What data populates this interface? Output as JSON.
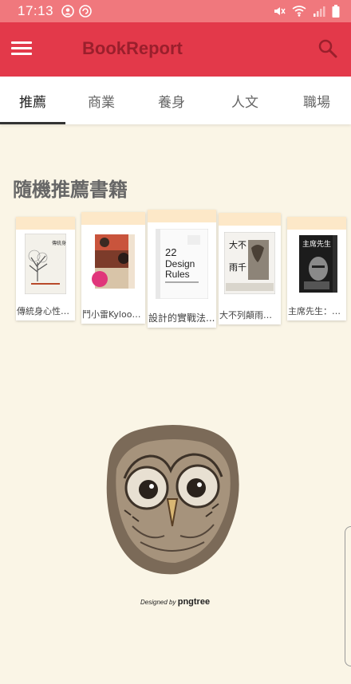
{
  "status_bar": {
    "time": "17:13"
  },
  "app_bar": {
    "title": "BookReport",
    "menu_icon": "hamburger-menu-icon",
    "search_icon": "search-icon"
  },
  "tabs": [
    {
      "label": "推薦",
      "active": true
    },
    {
      "label": "商業",
      "active": false
    },
    {
      "label": "養身",
      "active": false
    },
    {
      "label": "人文",
      "active": false
    },
    {
      "label": "職場",
      "active": false
    }
  ],
  "section": {
    "title": "隨機推薦書籍"
  },
  "books": [
    {
      "label": "傳統身心性命..."
    },
    {
      "label": "鬥小雷Kylooe..."
    },
    {
      "label": "設計的實戰法..."
    },
    {
      "label": "大不列顛雨千..."
    },
    {
      "label": "主席先生：聯..."
    }
  ],
  "credit": {
    "prefix": "Designed by",
    "brand": "pngtree"
  },
  "colors": {
    "status_bar": "#f0787d",
    "app_bar": "#e3394a",
    "title": "#9a1f2c",
    "background": "#faf5e6"
  }
}
